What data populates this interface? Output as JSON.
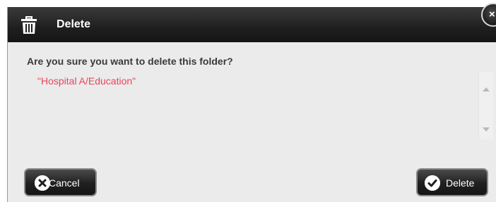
{
  "dialog": {
    "title": "Delete",
    "title_icon": "trash-icon",
    "close_label": "×",
    "question": "Are you sure you want to delete this folder?",
    "target": "\"Hospital A/Education\"",
    "cancel_label": "Cancel",
    "cancel_icon": "close-circle-icon",
    "delete_label": "Delete",
    "delete_icon": "check-circle-icon"
  },
  "colors": {
    "titlebar": "#1f1f1f",
    "body": "#ebebeb",
    "target_text": "#e8455a",
    "question_text": "#3a3a3a"
  }
}
